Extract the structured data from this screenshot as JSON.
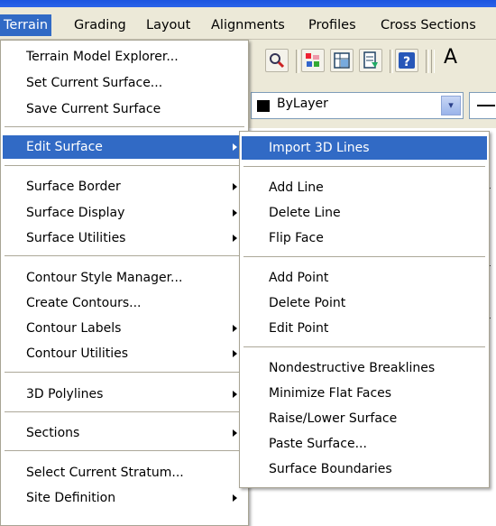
{
  "menubar": {
    "items": [
      "Terrain",
      "Grading",
      "Layout",
      "Alignments",
      "Profiles",
      "Cross Sections"
    ]
  },
  "toolbar": {
    "layer_value": "ByLayer",
    "combo_dropdown_glyph": "▾"
  },
  "terrain_menu": {
    "items": [
      {
        "label": "Terrain Model Explorer..."
      },
      {
        "label": "Set Current Surface..."
      },
      {
        "label": "Save Current Surface"
      },
      {
        "label": "Edit Surface",
        "submenu": true,
        "highlighted": true
      },
      {
        "label": "Surface Border",
        "submenu": true
      },
      {
        "label": "Surface Display",
        "submenu": true
      },
      {
        "label": "Surface Utilities",
        "submenu": true
      },
      {
        "label": "Contour Style Manager..."
      },
      {
        "label": "Create Contours..."
      },
      {
        "label": "Contour Labels",
        "submenu": true
      },
      {
        "label": "Contour Utilities",
        "submenu": true
      },
      {
        "label": "3D Polylines",
        "submenu": true
      },
      {
        "label": "Sections",
        "submenu": true
      },
      {
        "label": "Select Current Stratum..."
      },
      {
        "label": "Site Definition",
        "submenu": true
      }
    ]
  },
  "edit_surface_submenu": {
    "items": [
      {
        "label": "Import 3D Lines",
        "highlighted": true
      },
      {
        "label": "Add Line"
      },
      {
        "label": "Delete Line"
      },
      {
        "label": "Flip Face"
      },
      {
        "label": "Add Point"
      },
      {
        "label": "Delete Point"
      },
      {
        "label": "Edit Point"
      },
      {
        "label": "Nondestructive Breaklines"
      },
      {
        "label": "Minimize Flat Faces"
      },
      {
        "label": "Raise/Lower Surface"
      },
      {
        "label": "Paste Surface..."
      },
      {
        "label": "Surface Boundaries"
      }
    ]
  },
  "colors": {
    "highlight": "#316ac5",
    "menu_background": "#ffffff",
    "chrome": "#ece9d8",
    "titlebar": "#2a63e8"
  }
}
